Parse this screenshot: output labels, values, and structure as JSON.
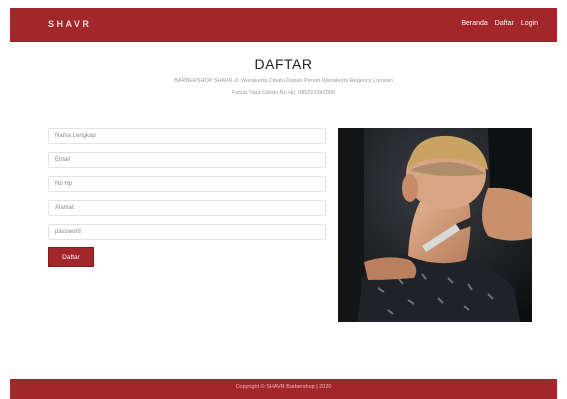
{
  "navbar": {
    "brand": "SHAVR",
    "links": [
      "Beranda",
      "Daftar",
      "Login"
    ]
  },
  "header": {
    "title": "DAFTAR",
    "subtitle_line1": "BARBERSHOP SHAVR Jl. Wanakerta Cibatu Depan Perum Wanakerta Regency Lurusan",
    "subtitle_line2": "Futsal Tiara Cibatu No.Hp. 085223342006"
  },
  "form": {
    "fields": [
      {
        "placeholder": "Nama Lengkap"
      },
      {
        "placeholder": "Email"
      },
      {
        "placeholder": "No Hp"
      },
      {
        "placeholder": "Alamat"
      },
      {
        "placeholder": "password"
      }
    ],
    "submit_label": "Daftar"
  },
  "image": {
    "icon": "barber-photo"
  },
  "footer": {
    "text": "Copyright © SHAVR Barbershop | 2020"
  },
  "colors": {
    "primary": "#a3262a",
    "background": "#ffffff"
  }
}
